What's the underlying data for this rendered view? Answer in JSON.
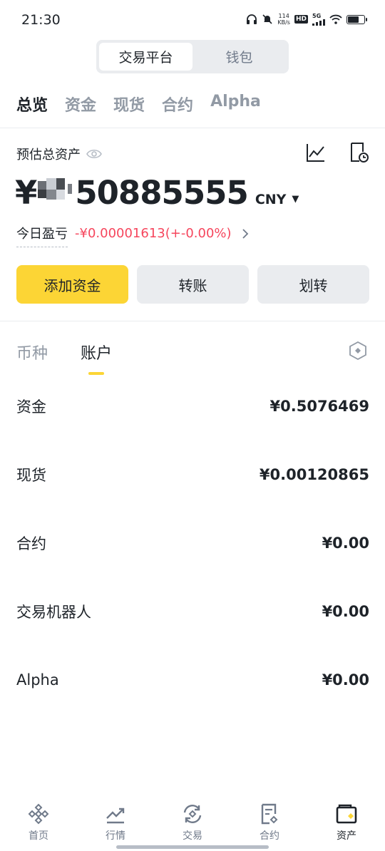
{
  "status_bar": {
    "time": "21:30",
    "net_speed_value": "114",
    "net_speed_unit": "KB/s",
    "hd": "HD",
    "signal_label": "5G"
  },
  "segment": {
    "items": [
      "交易平台",
      "钱包"
    ],
    "active_index": 0
  },
  "category_tabs": {
    "items": [
      "总览",
      "资金",
      "现货",
      "合约",
      "Alpha"
    ],
    "active_index": 0
  },
  "assets": {
    "label": "预估总资产",
    "currency_sign": "¥",
    "value_visible": "50885555",
    "unit": "CNY",
    "pnl_label": "今日盈亏",
    "pnl_value": "-¥0.00001613(+-0.00%)"
  },
  "actions": {
    "add_funds": "添加资金",
    "transfer": "转账",
    "internal_transfer": "划转"
  },
  "sub_tabs": {
    "items": [
      "币种",
      "账户"
    ],
    "active_index": 1
  },
  "accounts": [
    {
      "name": "资金",
      "value": "¥0.5076469"
    },
    {
      "name": "现货",
      "value": "¥0.00120865"
    },
    {
      "name": "合约",
      "value": "¥0.00"
    },
    {
      "name": "交易机器人",
      "value": "¥0.00"
    },
    {
      "name": "Alpha",
      "value": "¥0.00"
    }
  ],
  "bottom_nav": {
    "items": [
      "首页",
      "行情",
      "交易",
      "合约",
      "资产"
    ],
    "active_index": 4
  },
  "colors": {
    "accent": "#fcd535",
    "negative": "#f6465d",
    "text_primary": "#1e2329",
    "text_secondary": "#929aa5"
  },
  "icons": {
    "eye": "eye-icon",
    "chart": "line-chart-icon",
    "history": "document-clock-icon",
    "settings": "hexagon-settings-icon",
    "nav": [
      "binance-logo-icon",
      "market-trend-icon",
      "trade-exchange-icon",
      "futures-document-icon",
      "wallet-icon"
    ]
  }
}
